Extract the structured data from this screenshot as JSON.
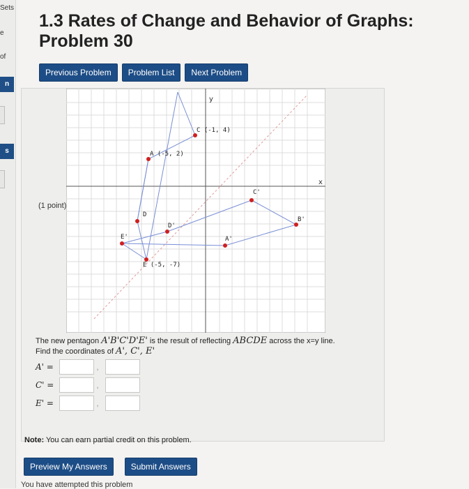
{
  "rail": {
    "sets": "Sets",
    "e": "e",
    "of": "of",
    "n": "n",
    "s": "s"
  },
  "title": "1.3 Rates of Change and Behavior of Graphs: Problem 30",
  "nav": {
    "previous": "Previous Problem",
    "list": "Problem List",
    "next": "Next Problem"
  },
  "point_label": "(1 point)",
  "graph": {
    "axis_y": "y",
    "axis_x": "x",
    "labels": {
      "C": "C (-1, 4)",
      "A": "A (-5, 2)",
      "D": "D",
      "E": "E (-5, -7)",
      "Cp": "C'",
      "Bp": "B'",
      "Ap": "A'",
      "Dp": "D'",
      "Ep": "E'"
    }
  },
  "prompt": {
    "pre": "The new pentagon ",
    "shape_new": "A'B'C'D'E'",
    "mid": " is the result of reflecting ",
    "shape_orig": "ABCDE",
    "post": " across the x=y line.",
    "find": "Find the coordinates of ",
    "find_vars": "A', C', E'"
  },
  "answers": {
    "A_label": "A' =",
    "C_label": "C' =",
    "E_label": "E' =",
    "A_x": "",
    "A_y": "",
    "C_x": "",
    "C_y": "",
    "E_x": "",
    "E_y": ""
  },
  "note": {
    "bold": "Note:",
    "text": " You can earn partial credit on this problem."
  },
  "actions": {
    "preview": "Preview My Answers",
    "submit": "Submit Answers"
  },
  "attempt_text": "You have attempted this problem"
}
